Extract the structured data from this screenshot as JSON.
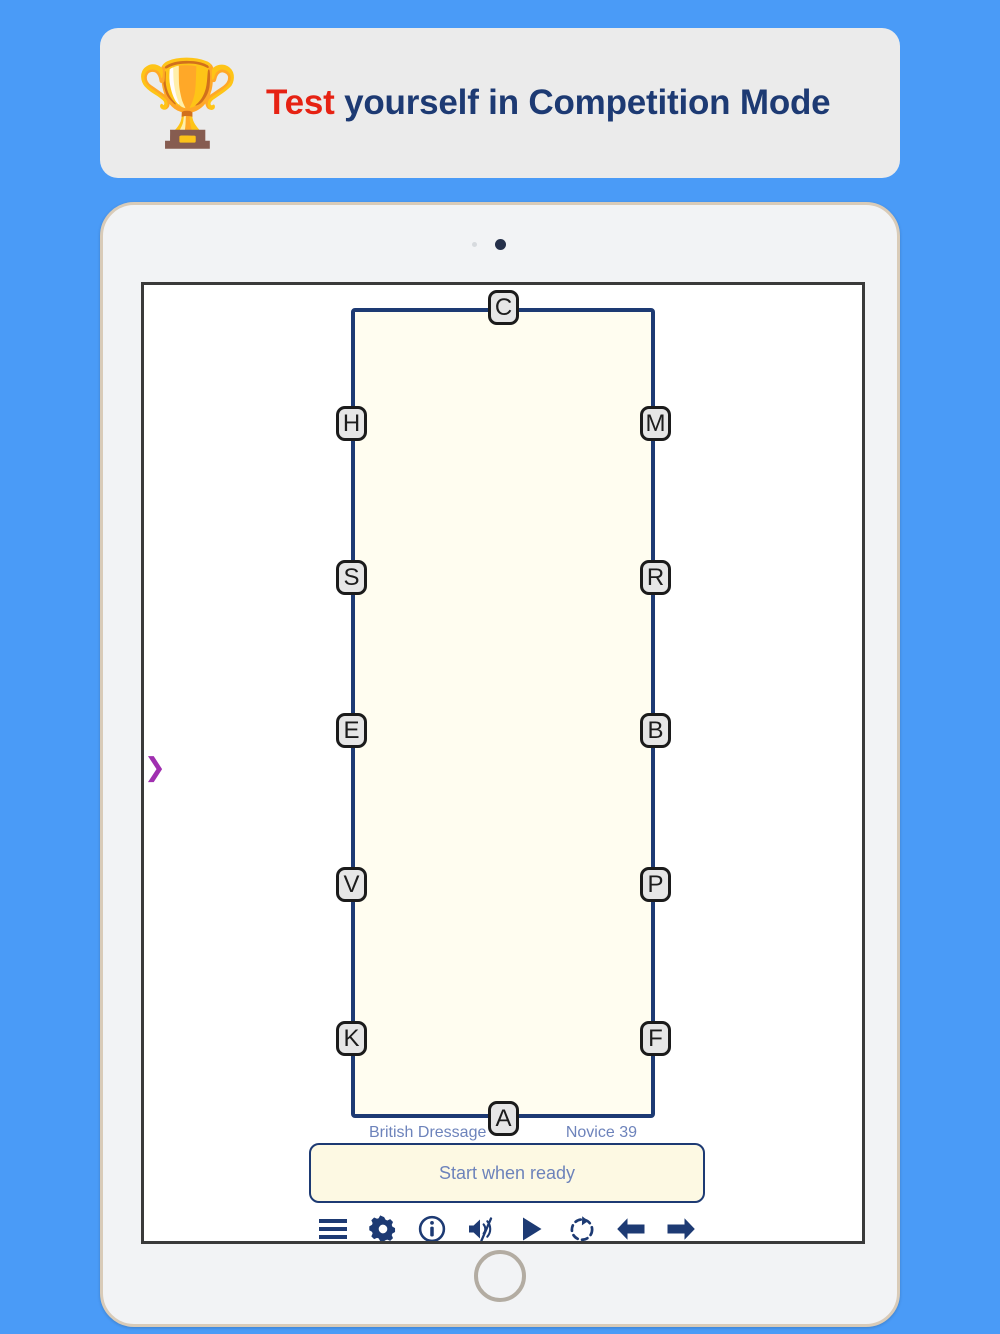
{
  "banner": {
    "icon": "trophy-icon",
    "icon_glyph": "🏆",
    "text_accent": "Test",
    "text_rest": " yourself in Competition Mode",
    "accent_color": "#e62213",
    "text_color": "#1d3a73",
    "background_color": "#ebebeb"
  },
  "device": {
    "type": "tablet",
    "frame_color": "#d9cbb8",
    "bezel_color": "#f2f3f5"
  },
  "screen": {
    "background_color": "#ffffff",
    "edge_marker": "❯"
  },
  "arena": {
    "fill_color": "#fffdf0",
    "border_color": "#1d3a73",
    "markers_left": [
      {
        "label": "H",
        "top_pct": 12.6
      },
      {
        "label": "S",
        "top_pct": 31.5
      },
      {
        "label": "E",
        "top_pct": 50.4
      },
      {
        "label": "V",
        "top_pct": 69.4
      },
      {
        "label": "K",
        "top_pct": 88.3
      }
    ],
    "markers_right": [
      {
        "label": "M",
        "top_pct": 12.6
      },
      {
        "label": "R",
        "top_pct": 31.5
      },
      {
        "label": "B",
        "top_pct": 50.4
      },
      {
        "label": "P",
        "top_pct": 69.4
      },
      {
        "label": "F",
        "top_pct": 88.3
      }
    ],
    "marker_top": {
      "label": "C"
    },
    "marker_bottom": {
      "label": "A"
    }
  },
  "caption": {
    "organisation": "British Dressage",
    "test_name": "Novice 39",
    "text_color": "#6d83bb"
  },
  "status": {
    "message": "Start when ready",
    "background_color": "#fdf9e3",
    "border_color": "#1d3a73",
    "text_color": "#6d83bb"
  },
  "toolbar": {
    "icon_color": "#1d3a73",
    "items": [
      {
        "name": "menu-icon",
        "label": "Menu"
      },
      {
        "name": "gear-icon",
        "label": "Settings"
      },
      {
        "name": "info-icon",
        "label": "Information"
      },
      {
        "name": "speaker-mute-icon",
        "label": "Sound muted"
      },
      {
        "name": "play-icon",
        "label": "Play"
      },
      {
        "name": "reset-icon",
        "label": "Restart"
      },
      {
        "name": "arrow-left-icon",
        "label": "Previous"
      },
      {
        "name": "arrow-right-icon",
        "label": "Next"
      }
    ]
  }
}
